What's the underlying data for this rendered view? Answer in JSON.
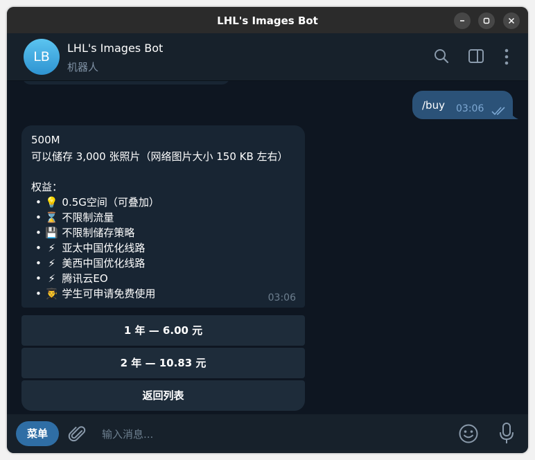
{
  "window": {
    "title": "LHL's Images Bot"
  },
  "header": {
    "avatar_initials": "LB",
    "name": "LHL's Images Bot",
    "subtitle": "机器人"
  },
  "outgoing": {
    "text": "/buy",
    "time": "03:06"
  },
  "incoming": {
    "lines": [
      "500M",
      "可以储存 3,000 张照片（网络图片大小 150 KB 左右）",
      "",
      "权益："
    ],
    "benefits": [
      {
        "emoji": "💡",
        "text": "0.5G空间（可叠加）"
      },
      {
        "emoji": "⌛",
        "text": "不限制流量"
      },
      {
        "emoji": "💾",
        "text": "不限制储存策略"
      },
      {
        "emoji": "⚡",
        "text": "亚太中国优化线路"
      },
      {
        "emoji": "⚡",
        "text": "美西中国优化线路"
      },
      {
        "emoji": "⚡",
        "text": "腾讯云EO"
      },
      {
        "emoji": "👨‍🎓",
        "text": "学生可申请免费使用"
      }
    ],
    "time": "03:06"
  },
  "keyboard": [
    {
      "label": "1 年 — 6.00 元"
    },
    {
      "label": "2 年 — 10.83 元"
    },
    {
      "label": "返回列表"
    }
  ],
  "composer": {
    "menu_label": "菜单",
    "placeholder": "输入消息..."
  },
  "colors": {
    "accent": "#2f6ea5",
    "outgoing_bubble": "#2b5278",
    "incoming_bubble": "#182533",
    "chat_bg": "#0e1621"
  }
}
